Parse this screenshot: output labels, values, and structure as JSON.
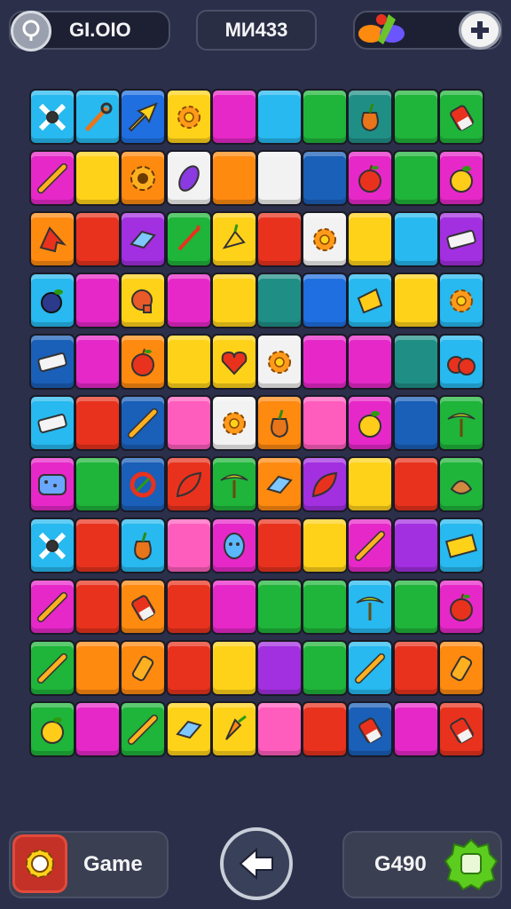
{
  "hud": {
    "left_value": "GI.OIO",
    "center_value": "MИ433",
    "pin_icon": "pin-icon",
    "gem_icon": "gem-cluster-icon",
    "plus_icon": "plus-icon"
  },
  "board": {
    "columns": 9,
    "rows": 12,
    "palette": {
      "cyan": "#27b9ef",
      "blue": "#1f6fe0",
      "yellow": "#ffd21a",
      "magenta": "#e628c8",
      "green": "#1fb43a",
      "teal": "#1f8f86",
      "purple": "#a22fe0",
      "orange": "#ff8a10",
      "white": "#f2f2f2",
      "red": "#e8321e",
      "pink": "#ff5dbd",
      "navy": "#1a5fb8"
    },
    "tiles": [
      [
        "cyan:bone-cross",
        "cyan:wrench",
        "blue:arrow",
        "yellow:flower",
        "magenta:",
        "cyan:",
        "green:",
        "teal:pepper",
        "green:",
        "green:battery"
      ],
      [
        "magenta:pen",
        "yellow:",
        "orange:gear",
        "white:gem",
        "orange:",
        "white:",
        "navy:",
        "magenta:apple",
        "green:",
        "magenta:apple-yellow"
      ],
      [
        "orange:ribbon",
        "red:",
        "purple:block",
        "green:hook",
        "yellow:fruit",
        "red:",
        "white:flower",
        "yellow:",
        "cyan:",
        "purple:eraser"
      ],
      [
        "cyan:berry",
        "magenta:",
        "yellow:fist",
        "magenta:",
        "yellow:",
        "teal:",
        "blue:",
        "cyan:paper",
        "yellow:",
        "cyan:flower"
      ],
      [
        "navy:eraser",
        "magenta:",
        "orange:apple",
        "yellow:",
        "yellow:heart",
        "white:flower",
        "magenta:",
        "magenta:",
        "teal:",
        "cyan:cherry"
      ],
      [
        "cyan:eraser",
        "red:",
        "navy:pen",
        "pink:",
        "white:flower",
        "orange:pepper",
        "pink:",
        "magenta:apple-yellow",
        "navy:",
        "green:palm"
      ],
      [
        "magenta:sponge",
        "green:",
        "navy:ring",
        "red:leaf",
        "green:palm",
        "orange:block",
        "purple:leaf",
        "yellow:",
        "red:",
        "green:bag"
      ],
      [
        "cyan:bone-cross",
        "red:",
        "cyan:pepper",
        "pink:",
        "magenta:blob",
        "red:",
        "yellow:",
        "magenta:pen",
        "purple:",
        "cyan:ticket"
      ],
      [
        "magenta:pen",
        "red:",
        "orange:battery",
        "red:",
        "magenta:",
        "green:",
        "green:",
        "cyan:palm",
        "green:",
        "magenta:apple"
      ],
      [
        "green:pen",
        "orange:",
        "orange:bottle",
        "red:",
        "yellow:",
        "purple:",
        "green:",
        "cyan:pen",
        "red:",
        "orange:bottle"
      ],
      [
        "green:apple-yellow",
        "magenta:",
        "green:pen",
        "yellow:block",
        "yellow:carrot",
        "pink:",
        "red:",
        "navy:battery",
        "magenta:",
        "red:battery"
      ]
    ]
  },
  "footer": {
    "game_label": "Game",
    "gear_icon": "gear-icon",
    "back_icon": "back-arrow-icon",
    "coins_value": "G490",
    "badge_icon": "coin-badge-icon"
  }
}
